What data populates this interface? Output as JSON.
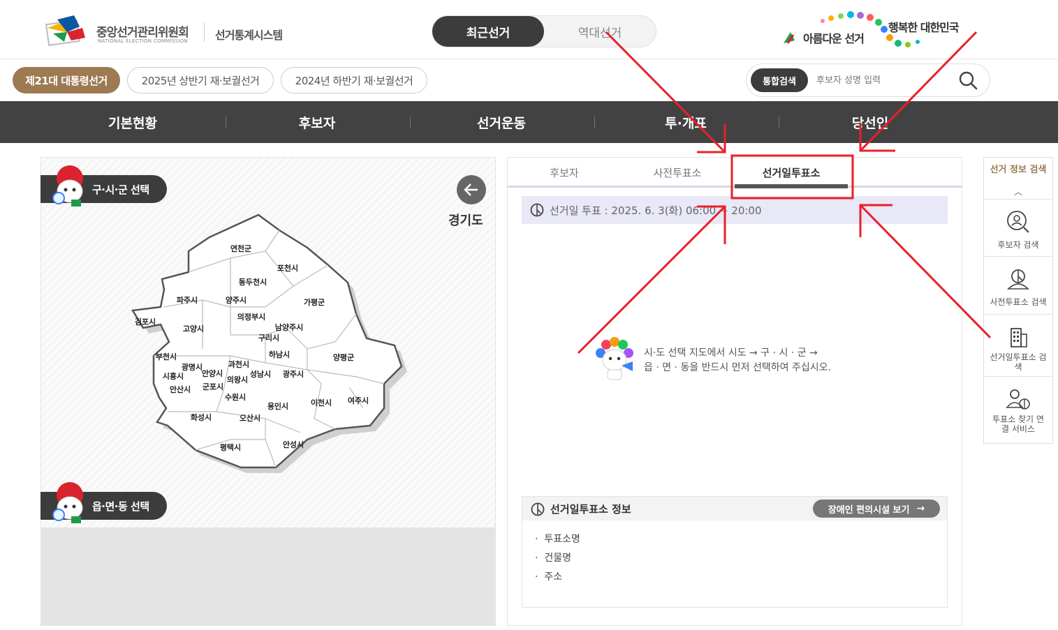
{
  "header": {
    "org_name_kr": "중앙선거관리위원회",
    "org_name_en": "NATIONAL ELECTION COMMISSION",
    "system_name": "선거통계시스템",
    "toggle": {
      "recent": "최근선거",
      "history": "역대선거"
    },
    "slogan_left": "아름다운 선거",
    "slogan_right": "행복한 대한민국"
  },
  "elections": [
    "제21대 대통령선거",
    "2025년 상반기 재·보궐선거",
    "2024년 하반기 재·보궐선거"
  ],
  "search": {
    "button": "통합검색",
    "placeholder": "후보자 성명 입력"
  },
  "nav": [
    "기본현황",
    "후보자",
    "선거운동",
    "투·개표",
    "당선인"
  ],
  "map": {
    "select_gu": "구·시·군 선택",
    "select_dong": "읍·면·동 선택",
    "province": "경기도",
    "districts": [
      "연천군",
      "포천시",
      "동두천시",
      "파주시",
      "양주시",
      "가평군",
      "의정부시",
      "김포시",
      "고양시",
      "남양주시",
      "구리시",
      "하남시",
      "양평군",
      "부천시",
      "광명시",
      "과천시",
      "안양시",
      "시흥시",
      "의왕시",
      "성남시",
      "광주시",
      "안산시",
      "군포시",
      "수원시",
      "용인시",
      "이천시",
      "여주시",
      "화성시",
      "오산시",
      "평택시",
      "안성시"
    ]
  },
  "tabs": [
    "후보자",
    "사전투표소",
    "선거일투표소"
  ],
  "vote_time": "선거일 투표 : 2025. 6. 3(화) 06:00 ~ 20:00",
  "guide": [
    "시·도 선택 지도에서 시도 → 구 · 시 · 군 →",
    "읍 · 면 · 동을 반드시 먼저 선택하여 주십시오."
  ],
  "info": {
    "title": "선거일투표소 정보",
    "accessibility_button": "장애인 편의시설 보기",
    "items": [
      "투표소명",
      "건물명",
      "주소"
    ]
  },
  "side": {
    "title": "선거 정보 검색",
    "items": [
      "후보자 검색",
      "사전투표소 검색",
      "선거일투표소 검색",
      "투표소 찾기 연결 서비스"
    ]
  },
  "colors": {
    "brand": "#9d7a52",
    "dark": "#3c3c3c",
    "nav": "#424242",
    "annotation": "#e8202a"
  }
}
